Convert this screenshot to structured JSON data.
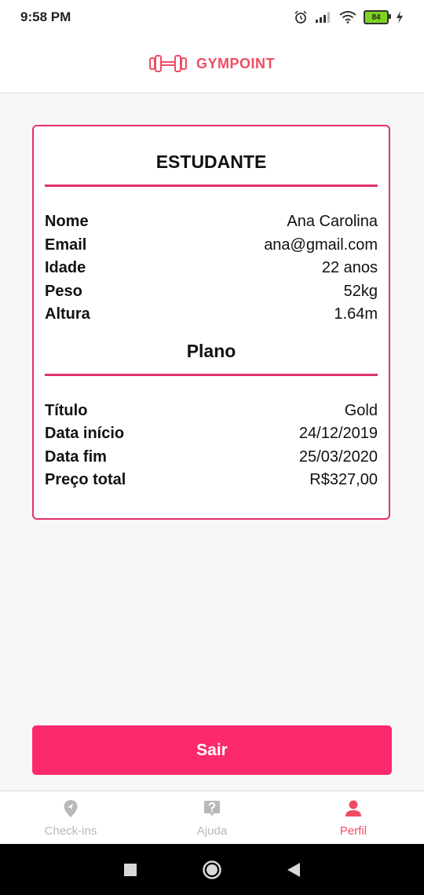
{
  "status_bar": {
    "time": "9:58 PM",
    "battery": "84"
  },
  "header": {
    "brand": "GYMPOINT"
  },
  "student_card": {
    "title": "ESTUDANTE",
    "fields": [
      {
        "label": "Nome",
        "value": "Ana Carolina"
      },
      {
        "label": "Email",
        "value": "ana@gmail.com"
      },
      {
        "label": "Idade",
        "value": "22 anos"
      },
      {
        "label": "Peso",
        "value": "52kg"
      },
      {
        "label": "Altura",
        "value": "1.64m"
      }
    ],
    "plan_title": "Plano",
    "plan_fields": [
      {
        "label": "Título",
        "value": "Gold"
      },
      {
        "label": "Data início",
        "value": "24/12/2019"
      },
      {
        "label": "Data fim",
        "value": "25/03/2020"
      },
      {
        "label": "Preço total",
        "value": "R$327,00"
      }
    ]
  },
  "logout_label": "Sair",
  "tabs": [
    {
      "label": "Check-ins",
      "icon": "location-pin-icon",
      "active": false
    },
    {
      "label": "Ajuda",
      "icon": "help-question-icon",
      "active": false
    },
    {
      "label": "Perfil",
      "icon": "person-icon",
      "active": true
    }
  ],
  "colors": {
    "brand": "#ee4d64",
    "accent_border": "#e0316d",
    "button": "#fc2a6c"
  }
}
